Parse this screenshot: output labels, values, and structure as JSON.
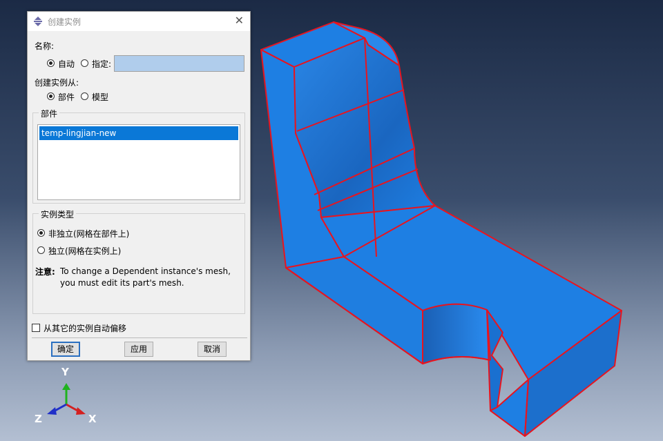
{
  "dialog": {
    "title": "创建实例",
    "name_label": "名称:",
    "name_auto": "自动",
    "name_specify": "指定:",
    "name_value": "",
    "from_label": "创建实例从:",
    "from_part": "部件",
    "from_model": "模型",
    "parts_group": "部件",
    "parts": [
      "temp-lingjian-new"
    ],
    "instance_type_group": "实例类型",
    "dependent": "非独立(网格在部件上)",
    "independent": "独立(网格在实例上)",
    "note_label": "注意:",
    "note_text": "To change a Dependent instance's mesh, you must edit its part's mesh.",
    "auto_offset": "从其它的实例自动偏移",
    "ok": "确定",
    "apply": "应用",
    "cancel": "取消"
  },
  "state": {
    "name_mode": "自动",
    "from": "部件",
    "instance_type": "非独立(网格在部件上)",
    "auto_offset_checked": false,
    "selected_part": "temp-lingjian-new"
  },
  "triad": {
    "x": "X",
    "y": "Y",
    "z": "Z"
  },
  "colors": {
    "part_face": "#1e7fe3",
    "part_edges": "#e8141e",
    "selection": "#0a78d7",
    "x_axis": "#d42020",
    "y_axis": "#1fb31f",
    "z_axis": "#2030c8"
  }
}
